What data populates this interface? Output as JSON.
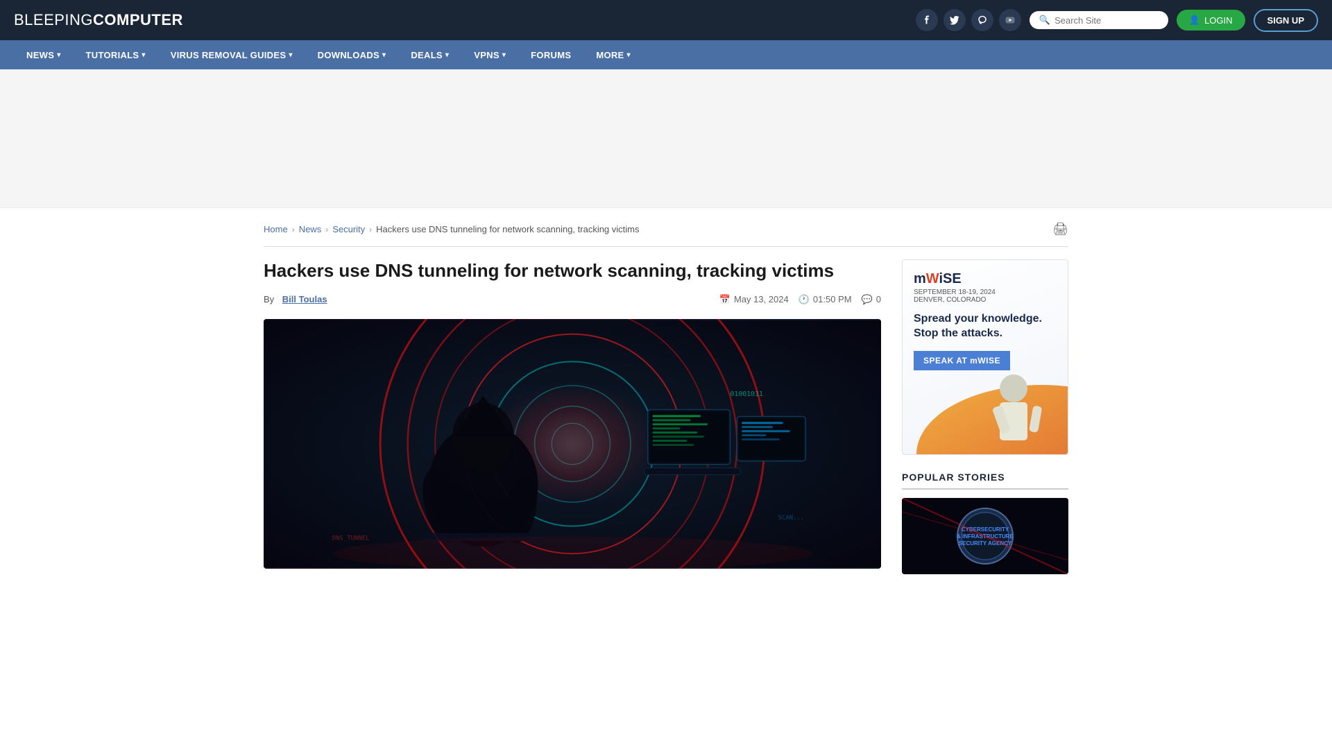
{
  "header": {
    "logo_light": "BLEEPING",
    "logo_bold": "COMPUTER",
    "search_placeholder": "Search Site",
    "login_label": "LOGIN",
    "signup_label": "SIGN UP",
    "social": [
      {
        "name": "facebook",
        "icon": "f"
      },
      {
        "name": "twitter",
        "icon": "t"
      },
      {
        "name": "mastodon",
        "icon": "m"
      },
      {
        "name": "youtube",
        "icon": "▶"
      }
    ]
  },
  "nav": {
    "items": [
      {
        "label": "NEWS",
        "has_dropdown": true
      },
      {
        "label": "TUTORIALS",
        "has_dropdown": true
      },
      {
        "label": "VIRUS REMOVAL GUIDES",
        "has_dropdown": true
      },
      {
        "label": "DOWNLOADS",
        "has_dropdown": true
      },
      {
        "label": "DEALS",
        "has_dropdown": true
      },
      {
        "label": "VPNS",
        "has_dropdown": true
      },
      {
        "label": "FORUMS",
        "has_dropdown": false
      },
      {
        "label": "MORE",
        "has_dropdown": true
      }
    ]
  },
  "breadcrumb": {
    "items": [
      {
        "label": "Home",
        "href": "#"
      },
      {
        "label": "News",
        "href": "#"
      },
      {
        "label": "Security",
        "href": "#"
      },
      {
        "label": "Hackers use DNS tunneling for network scanning, tracking victims",
        "href": null
      }
    ]
  },
  "article": {
    "title": "Hackers use DNS tunneling for network scanning, tracking victims",
    "author": "Bill Toulas",
    "by_label": "By",
    "date": "May 13, 2024",
    "time": "01:50 PM",
    "comments_count": "0"
  },
  "sidebar": {
    "ad": {
      "logo": "mWISE",
      "logo_accent": "W",
      "date_line": "SEPTEMBER 18-19, 2024",
      "location": "DENVER, COLORADO",
      "tagline_line1": "Spread your knowledge.",
      "tagline_line2": "Stop the attacks.",
      "cta_label": "SPEAK AT mWISE"
    },
    "popular_stories": {
      "title": "POPULAR STORIES"
    }
  }
}
